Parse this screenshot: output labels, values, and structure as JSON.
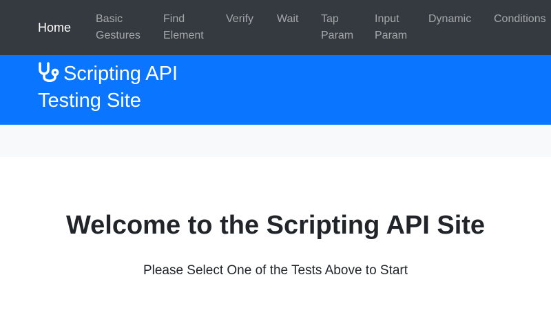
{
  "nav": {
    "home": "Home",
    "basic_gestures": "Basic\nGestures",
    "find_element": "Find\nElement",
    "verify": "Verify",
    "wait": "Wait",
    "tap_param": "Tap\nParam",
    "input_param": "Input\nParam",
    "dynamic": "Dynamic",
    "conditions": "Conditions"
  },
  "brand": {
    "icon": "stethoscope-icon",
    "line1": "Scripting API",
    "line2": "Testing Site"
  },
  "main": {
    "title": "Welcome to the Scripting API Site",
    "subtitle": "Please Select One of the Tests Above to Start"
  },
  "colors": {
    "nav_background": "#343a40",
    "brand_background": "#0a76ff",
    "subbar_background": "#f8f9fa",
    "text": "#212529"
  }
}
